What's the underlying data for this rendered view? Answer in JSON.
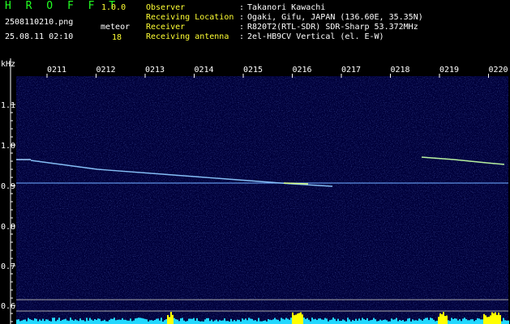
{
  "app": {
    "title": "H R O F F T",
    "version": "1.0.0"
  },
  "file": {
    "name": "2508110210.png",
    "datetime": "25.08.11 02:10"
  },
  "meteor": {
    "label": "meteor",
    "count": "18"
  },
  "info": [
    {
      "label": "Observer",
      "value": "Takanori Kawachi"
    },
    {
      "label": "Receiving Location",
      "value": "Ogaki, Gifu, JAPAN (136.60E, 35.35N)"
    },
    {
      "label": "Receiver",
      "value": "R820T2(RTL-SDR) SDR-Sharp 53.372MHz"
    },
    {
      "label": "Receiving antenna",
      "value": "2el-HB9CV Vertical (el. E-W)"
    }
  ],
  "axis": {
    "unit": "kHz",
    "y_ticks": [
      "1.1",
      "1.0",
      "0.9",
      "0.8",
      "0.7",
      "0.6"
    ],
    "time_ticks": [
      "0211",
      "0212",
      "0213",
      "0214",
      "0215",
      "0216",
      "0217",
      "0218",
      "0219",
      "0220"
    ]
  },
  "colors": {
    "bg": "#00003a",
    "carrier": "#6ea8ff",
    "trace": "#9fd0ff",
    "bars": "#22d8ff",
    "bursts": "#ffff00"
  }
}
